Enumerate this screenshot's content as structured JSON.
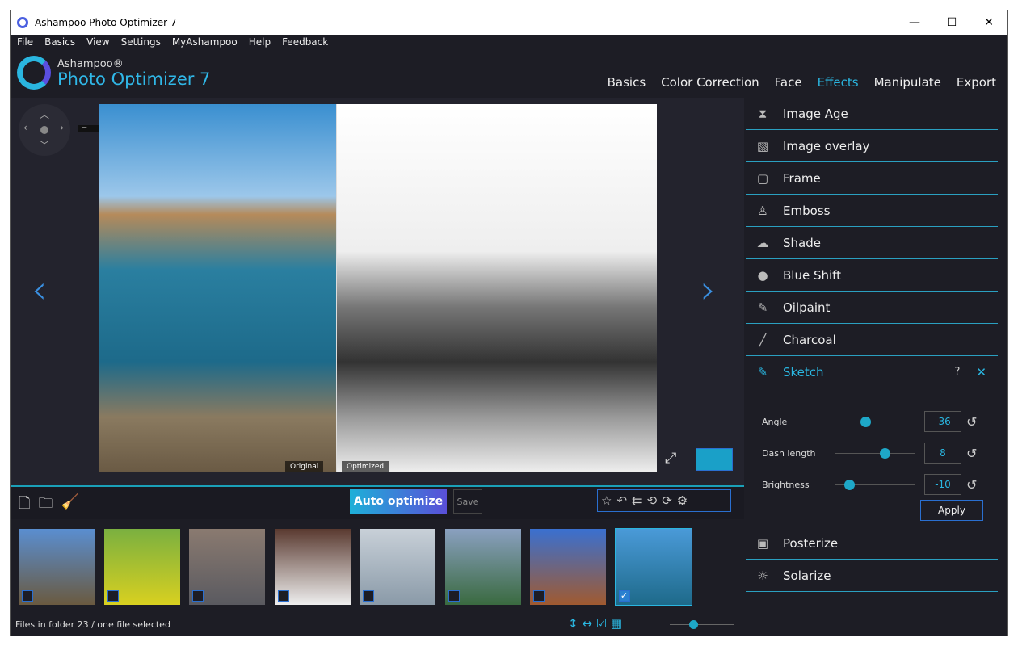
{
  "window": {
    "title": "Ashampoo Photo Optimizer 7",
    "min": "—",
    "max": "☐",
    "close": "✕"
  },
  "menu": [
    "File",
    "Basics",
    "View",
    "Settings",
    "MyAshampoo",
    "Help",
    "Feedback"
  ],
  "brand": {
    "small": "Ashampoo®",
    "big": "Photo Optimizer 7"
  },
  "tabs": [
    "Basics",
    "Color Correction",
    "Face",
    "Effects",
    "Manipulate",
    "Export"
  ],
  "image": {
    "original_label": "Original",
    "optimized_label": "Optimized"
  },
  "effects": [
    {
      "label": "Image Age",
      "icon": "⧗"
    },
    {
      "label": "Image overlay",
      "icon": "▧"
    },
    {
      "label": "Frame",
      "icon": "▢"
    },
    {
      "label": "Emboss",
      "icon": "♙"
    },
    {
      "label": "Shade",
      "icon": "☁"
    },
    {
      "label": "Blue Shift",
      "icon": "●"
    },
    {
      "label": "Oilpaint",
      "icon": "✎"
    },
    {
      "label": "Charcoal",
      "icon": "╱"
    },
    {
      "label": "Sketch",
      "icon": "✎"
    }
  ],
  "effects_after": [
    {
      "label": "Posterize",
      "icon": "▣"
    },
    {
      "label": "Solarize",
      "icon": "☼"
    }
  ],
  "sketch": {
    "help": "?",
    "close": "✕",
    "params": [
      {
        "label": "Angle",
        "value": "-36",
        "pos": 0.38
      },
      {
        "label": "Dash length",
        "value": "8",
        "pos": 0.62
      },
      {
        "label": "Brightness",
        "value": "-10",
        "pos": 0.18
      }
    ],
    "apply": "Apply"
  },
  "toolbar": {
    "auto": "Auto optimize",
    "save": "Save"
  },
  "thumbs": [
    {
      "c1": "#5a8ed0",
      "c2": "#6a5a40",
      "checked": false
    },
    {
      "c1": "#7ab040",
      "c2": "#d8d020",
      "checked": false
    },
    {
      "c1": "#8a7a70",
      "c2": "#5a5a60",
      "checked": false
    },
    {
      "c1": "#5a3a30",
      "c2": "#eee",
      "checked": false
    },
    {
      "c1": "#c8d0d8",
      "c2": "#8a9aa8",
      "checked": false
    },
    {
      "c1": "#8aa0c0",
      "c2": "#3a6a40",
      "checked": false
    },
    {
      "c1": "#3a70d0",
      "c2": "#a05a30",
      "checked": false
    },
    {
      "c1": "#4a9ad8",
      "c2": "#1e6a8a",
      "checked": true
    }
  ],
  "status": "Files in folder 23 / one file selected"
}
